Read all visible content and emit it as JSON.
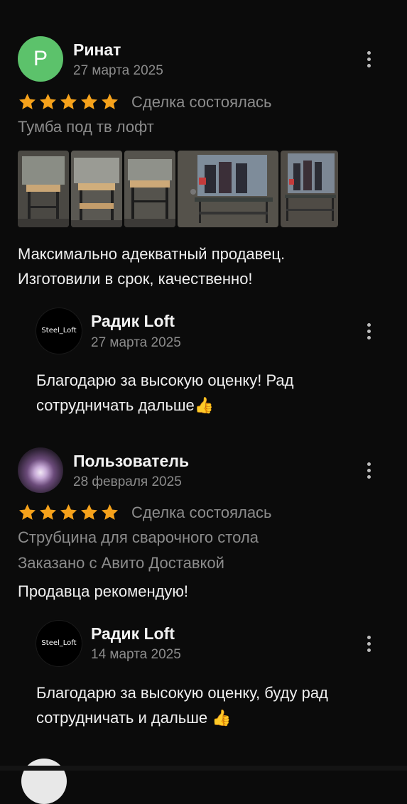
{
  "colors": {
    "star": "#f6a21b",
    "avatar_green": "#5cc26b",
    "muted_text": "#8c8c8c",
    "background": "#0b0b0b"
  },
  "reviews": [
    {
      "avatar_letter": "Р",
      "author": "Ринат",
      "date": "27 марта 2025",
      "rating": 5,
      "deal_status": "Сделка состоялась",
      "item": "Тумба под тв лофт",
      "delivery": "",
      "text_lines": [
        "Максимально адекватный продавец.",
        "Изготовили в срок, качественно!"
      ],
      "reply": {
        "logo": "Steel_Loft",
        "author": "Радик Loft",
        "date": "27 марта 2025",
        "text_lines": [
          "Благодарю за высокую оценку! Рад",
          "сотрудничать дальше👍"
        ]
      }
    },
    {
      "avatar_letter": "",
      "author": "Пользователь",
      "date": "28 февраля 2025",
      "rating": 5,
      "deal_status": "Сделка состоялась",
      "item": "Струбцина для сварочного стола",
      "delivery": "Заказано с Авито Доставкой",
      "text_lines": [
        "Продавца рекомендую!"
      ],
      "reply": {
        "logo": "Steel_Loft",
        "author": "Радик Loft",
        "date": "14 марта 2025",
        "text_lines": [
          "Благодарю за высокую оценку, буду рад",
          "сотрудничать и дальше 👍"
        ]
      }
    }
  ]
}
